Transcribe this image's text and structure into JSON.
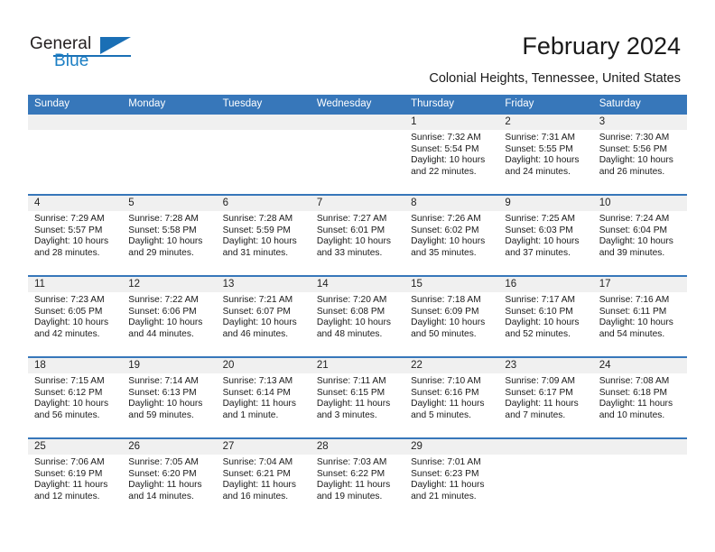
{
  "brand": {
    "line1": "General",
    "line2": "Blue",
    "accent_color": "#1a6fb5"
  },
  "header": {
    "title": "February 2024",
    "subtitle": "Colonial Heights, Tennessee, United States",
    "header_bg_color": "#3777ba",
    "daynum_band_color": "#f0f0f0"
  },
  "weekday_headers": [
    "Sunday",
    "Monday",
    "Tuesday",
    "Wednesday",
    "Thursday",
    "Friday",
    "Saturday"
  ],
  "weeks": [
    {
      "days": [
        {
          "num": "",
          "sunrise": "",
          "sunset": "",
          "daylight_line1": "",
          "daylight_line2": "",
          "empty": true
        },
        {
          "num": "",
          "sunrise": "",
          "sunset": "",
          "daylight_line1": "",
          "daylight_line2": "",
          "empty": true
        },
        {
          "num": "",
          "sunrise": "",
          "sunset": "",
          "daylight_line1": "",
          "daylight_line2": "",
          "empty": true
        },
        {
          "num": "",
          "sunrise": "",
          "sunset": "",
          "daylight_line1": "",
          "daylight_line2": "",
          "empty": true
        },
        {
          "num": "1",
          "sunrise": "Sunrise: 7:32 AM",
          "sunset": "Sunset: 5:54 PM",
          "daylight_line1": "Daylight: 10 hours",
          "daylight_line2": "and 22 minutes.",
          "empty": false
        },
        {
          "num": "2",
          "sunrise": "Sunrise: 7:31 AM",
          "sunset": "Sunset: 5:55 PM",
          "daylight_line1": "Daylight: 10 hours",
          "daylight_line2": "and 24 minutes.",
          "empty": false
        },
        {
          "num": "3",
          "sunrise": "Sunrise: 7:30 AM",
          "sunset": "Sunset: 5:56 PM",
          "daylight_line1": "Daylight: 10 hours",
          "daylight_line2": "and 26 minutes.",
          "empty": false
        }
      ]
    },
    {
      "days": [
        {
          "num": "4",
          "sunrise": "Sunrise: 7:29 AM",
          "sunset": "Sunset: 5:57 PM",
          "daylight_line1": "Daylight: 10 hours",
          "daylight_line2": "and 28 minutes.",
          "empty": false
        },
        {
          "num": "5",
          "sunrise": "Sunrise: 7:28 AM",
          "sunset": "Sunset: 5:58 PM",
          "daylight_line1": "Daylight: 10 hours",
          "daylight_line2": "and 29 minutes.",
          "empty": false
        },
        {
          "num": "6",
          "sunrise": "Sunrise: 7:28 AM",
          "sunset": "Sunset: 5:59 PM",
          "daylight_line1": "Daylight: 10 hours",
          "daylight_line2": "and 31 minutes.",
          "empty": false
        },
        {
          "num": "7",
          "sunrise": "Sunrise: 7:27 AM",
          "sunset": "Sunset: 6:01 PM",
          "daylight_line1": "Daylight: 10 hours",
          "daylight_line2": "and 33 minutes.",
          "empty": false
        },
        {
          "num": "8",
          "sunrise": "Sunrise: 7:26 AM",
          "sunset": "Sunset: 6:02 PM",
          "daylight_line1": "Daylight: 10 hours",
          "daylight_line2": "and 35 minutes.",
          "empty": false
        },
        {
          "num": "9",
          "sunrise": "Sunrise: 7:25 AM",
          "sunset": "Sunset: 6:03 PM",
          "daylight_line1": "Daylight: 10 hours",
          "daylight_line2": "and 37 minutes.",
          "empty": false
        },
        {
          "num": "10",
          "sunrise": "Sunrise: 7:24 AM",
          "sunset": "Sunset: 6:04 PM",
          "daylight_line1": "Daylight: 10 hours",
          "daylight_line2": "and 39 minutes.",
          "empty": false
        }
      ]
    },
    {
      "days": [
        {
          "num": "11",
          "sunrise": "Sunrise: 7:23 AM",
          "sunset": "Sunset: 6:05 PM",
          "daylight_line1": "Daylight: 10 hours",
          "daylight_line2": "and 42 minutes.",
          "empty": false
        },
        {
          "num": "12",
          "sunrise": "Sunrise: 7:22 AM",
          "sunset": "Sunset: 6:06 PM",
          "daylight_line1": "Daylight: 10 hours",
          "daylight_line2": "and 44 minutes.",
          "empty": false
        },
        {
          "num": "13",
          "sunrise": "Sunrise: 7:21 AM",
          "sunset": "Sunset: 6:07 PM",
          "daylight_line1": "Daylight: 10 hours",
          "daylight_line2": "and 46 minutes.",
          "empty": false
        },
        {
          "num": "14",
          "sunrise": "Sunrise: 7:20 AM",
          "sunset": "Sunset: 6:08 PM",
          "daylight_line1": "Daylight: 10 hours",
          "daylight_line2": "and 48 minutes.",
          "empty": false
        },
        {
          "num": "15",
          "sunrise": "Sunrise: 7:18 AM",
          "sunset": "Sunset: 6:09 PM",
          "daylight_line1": "Daylight: 10 hours",
          "daylight_line2": "and 50 minutes.",
          "empty": false
        },
        {
          "num": "16",
          "sunrise": "Sunrise: 7:17 AM",
          "sunset": "Sunset: 6:10 PM",
          "daylight_line1": "Daylight: 10 hours",
          "daylight_line2": "and 52 minutes.",
          "empty": false
        },
        {
          "num": "17",
          "sunrise": "Sunrise: 7:16 AM",
          "sunset": "Sunset: 6:11 PM",
          "daylight_line1": "Daylight: 10 hours",
          "daylight_line2": "and 54 minutes.",
          "empty": false
        }
      ]
    },
    {
      "days": [
        {
          "num": "18",
          "sunrise": "Sunrise: 7:15 AM",
          "sunset": "Sunset: 6:12 PM",
          "daylight_line1": "Daylight: 10 hours",
          "daylight_line2": "and 56 minutes.",
          "empty": false
        },
        {
          "num": "19",
          "sunrise": "Sunrise: 7:14 AM",
          "sunset": "Sunset: 6:13 PM",
          "daylight_line1": "Daylight: 10 hours",
          "daylight_line2": "and 59 minutes.",
          "empty": false
        },
        {
          "num": "20",
          "sunrise": "Sunrise: 7:13 AM",
          "sunset": "Sunset: 6:14 PM",
          "daylight_line1": "Daylight: 11 hours",
          "daylight_line2": "and 1 minute.",
          "empty": false
        },
        {
          "num": "21",
          "sunrise": "Sunrise: 7:11 AM",
          "sunset": "Sunset: 6:15 PM",
          "daylight_line1": "Daylight: 11 hours",
          "daylight_line2": "and 3 minutes.",
          "empty": false
        },
        {
          "num": "22",
          "sunrise": "Sunrise: 7:10 AM",
          "sunset": "Sunset: 6:16 PM",
          "daylight_line1": "Daylight: 11 hours",
          "daylight_line2": "and 5 minutes.",
          "empty": false
        },
        {
          "num": "23",
          "sunrise": "Sunrise: 7:09 AM",
          "sunset": "Sunset: 6:17 PM",
          "daylight_line1": "Daylight: 11 hours",
          "daylight_line2": "and 7 minutes.",
          "empty": false
        },
        {
          "num": "24",
          "sunrise": "Sunrise: 7:08 AM",
          "sunset": "Sunset: 6:18 PM",
          "daylight_line1": "Daylight: 11 hours",
          "daylight_line2": "and 10 minutes.",
          "empty": false
        }
      ]
    },
    {
      "days": [
        {
          "num": "25",
          "sunrise": "Sunrise: 7:06 AM",
          "sunset": "Sunset: 6:19 PM",
          "daylight_line1": "Daylight: 11 hours",
          "daylight_line2": "and 12 minutes.",
          "empty": false
        },
        {
          "num": "26",
          "sunrise": "Sunrise: 7:05 AM",
          "sunset": "Sunset: 6:20 PM",
          "daylight_line1": "Daylight: 11 hours",
          "daylight_line2": "and 14 minutes.",
          "empty": false
        },
        {
          "num": "27",
          "sunrise": "Sunrise: 7:04 AM",
          "sunset": "Sunset: 6:21 PM",
          "daylight_line1": "Daylight: 11 hours",
          "daylight_line2": "and 16 minutes.",
          "empty": false
        },
        {
          "num": "28",
          "sunrise": "Sunrise: 7:03 AM",
          "sunset": "Sunset: 6:22 PM",
          "daylight_line1": "Daylight: 11 hours",
          "daylight_line2": "and 19 minutes.",
          "empty": false
        },
        {
          "num": "29",
          "sunrise": "Sunrise: 7:01 AM",
          "sunset": "Sunset: 6:23 PM",
          "daylight_line1": "Daylight: 11 hours",
          "daylight_line2": "and 21 minutes.",
          "empty": false
        },
        {
          "num": "",
          "sunrise": "",
          "sunset": "",
          "daylight_line1": "",
          "daylight_line2": "",
          "empty": true
        },
        {
          "num": "",
          "sunrise": "",
          "sunset": "",
          "daylight_line1": "",
          "daylight_line2": "",
          "empty": true
        }
      ]
    }
  ]
}
